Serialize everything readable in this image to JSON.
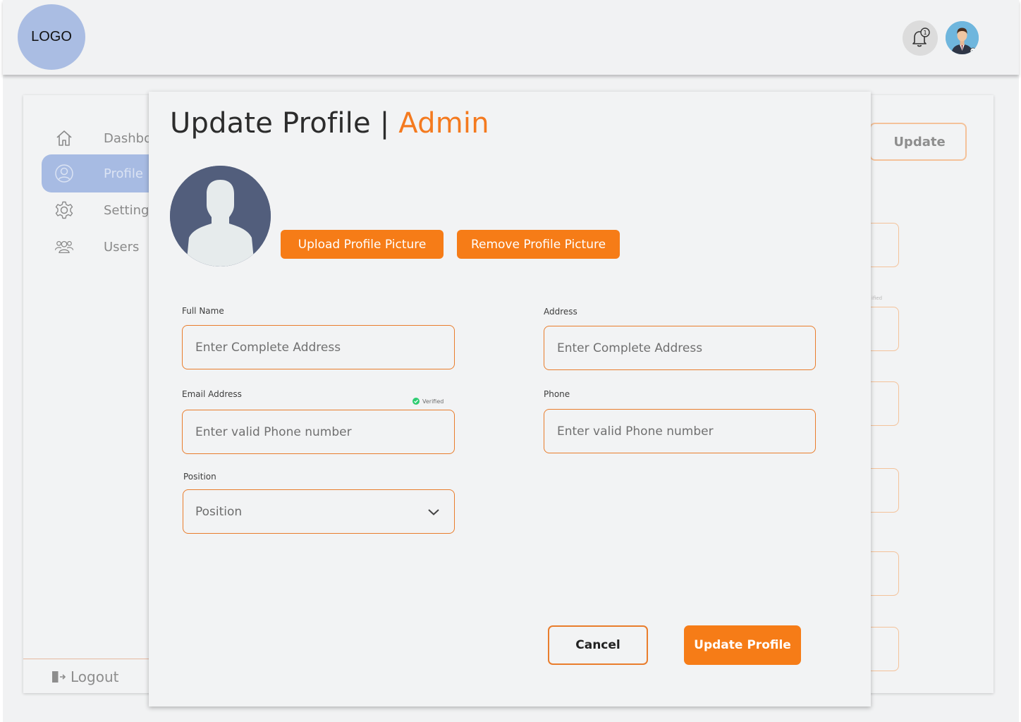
{
  "header": {
    "logo_text": "LOGO",
    "notification_count": "1"
  },
  "sidebar": {
    "items": [
      {
        "label": "Dashbo",
        "icon": "home-icon"
      },
      {
        "label": "Profile",
        "icon": "user-circle-icon",
        "active": true
      },
      {
        "label": "Setting",
        "icon": "gear-icon"
      },
      {
        "label": "Users",
        "icon": "users-icon"
      }
    ],
    "logout_label": "Logout"
  },
  "background_page": {
    "update_label": "Update",
    "verified_fragment": "ified"
  },
  "modal": {
    "title": "Update Profile",
    "separator": "|",
    "role": "Admin",
    "upload_label": "Upload Profile Picture",
    "remove_label": "Remove Profile Picture",
    "fields": {
      "full_name": {
        "label": "Full Name",
        "placeholder": "Enter Complete Address"
      },
      "address": {
        "label": "Address",
        "placeholder": "Enter Complete Address"
      },
      "email": {
        "label": "Email Address",
        "placeholder": "Enter valid Phone number",
        "status": "Verified"
      },
      "phone": {
        "label": "Phone",
        "placeholder": "Enter valid Phone number"
      },
      "position": {
        "label": "Position",
        "value": "Position"
      }
    },
    "cancel_label": "Cancel",
    "update_label": "Update Profile"
  },
  "colors": {
    "accent": "#f67c17",
    "logo_bg": "#aabde3",
    "active_nav": "#a7bbe3",
    "verified": "#2ecc71",
    "profile_pic_bg": "#525e7c"
  }
}
